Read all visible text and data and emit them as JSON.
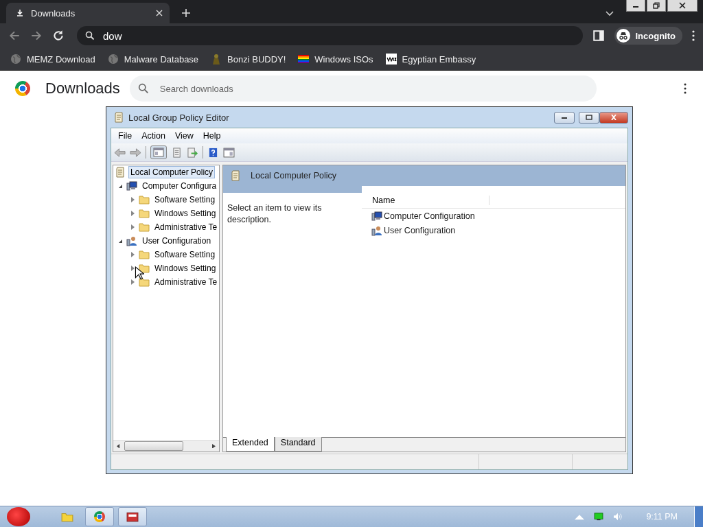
{
  "browser": {
    "tab": {
      "title": "Downloads"
    },
    "address": "dow",
    "profile": "Incognito",
    "bookmarks": [
      {
        "label": "MEMZ Download",
        "kind": "globe"
      },
      {
        "label": "Malware Database",
        "kind": "globe"
      },
      {
        "label": "Bonzi BUDDY!",
        "kind": "figure"
      },
      {
        "label": "Windows ISOs",
        "kind": "rainbow"
      },
      {
        "label": "Egyptian Embassy",
        "kind": "badge"
      }
    ]
  },
  "page": {
    "title": "Downloads",
    "search": {
      "placeholder": "Search downloads"
    }
  },
  "gpedit": {
    "title": "Local Group Policy Editor",
    "menu": [
      "File",
      "Action",
      "View",
      "Help"
    ],
    "tree": [
      {
        "label": "Local Computer Policy",
        "kind": "policy",
        "selected": true,
        "children": [
          {
            "label": "Computer Configura",
            "kind": "computer",
            "selected": false,
            "expanded": true,
            "children": [
              {
                "label": "Software Setting",
                "kind": "folder",
                "selected": false,
                "expanded": false
              },
              {
                "label": "Windows Setting",
                "kind": "folder",
                "selected": false,
                "expanded": false
              },
              {
                "label": "Administrative Te",
                "kind": "folder",
                "selected": false,
                "expanded": false
              }
            ]
          },
          {
            "label": "User Configuration",
            "kind": "user",
            "selected": false,
            "expanded": true,
            "children": [
              {
                "label": "Software Setting",
                "kind": "folder",
                "selected": false,
                "expanded": false
              },
              {
                "label": "Windows Setting",
                "kind": "folder",
                "selected": false,
                "expanded": false
              },
              {
                "label": "Administrative Te",
                "kind": "folder",
                "selected": false,
                "expanded": false
              }
            ]
          }
        ]
      }
    ],
    "header": "Local Computer Policy",
    "description": "Select an item to view its description.",
    "columns": [
      "Name"
    ],
    "rows": [
      {
        "label": "Computer Configuration",
        "kind": "computer"
      },
      {
        "label": "User Configuration",
        "kind": "user"
      }
    ],
    "view_tabs": [
      {
        "label": "Extended",
        "selected": true
      },
      {
        "label": "Standard",
        "selected": false
      }
    ]
  },
  "taskbar": {
    "clock": "9:11 PM"
  }
}
